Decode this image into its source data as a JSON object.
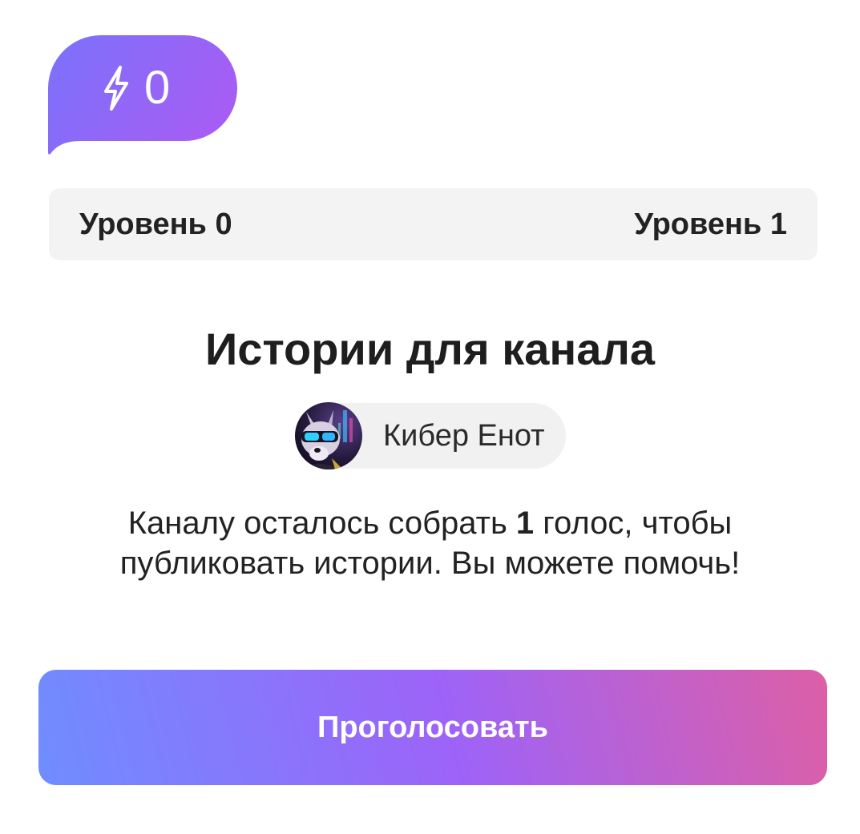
{
  "boost": {
    "count": "0",
    "icon": "lightning-bolt-icon",
    "gradient": [
      "#7a6ffb",
      "#a15cf4"
    ]
  },
  "levels": {
    "current": "Уровень 0",
    "next": "Уровень 1",
    "progress_fraction": 0
  },
  "title": "Истории для канала",
  "channel": {
    "name": "Кибер Енот",
    "avatar_icon": "raccoon-avatar-icon"
  },
  "description": {
    "before": "Каналу осталось собрать ",
    "count": "1",
    "after": " голос, чтобы публиковать истории. Вы можете помочь!"
  },
  "actions": {
    "vote_label": "Проголосовать"
  },
  "colors": {
    "accent_start": "#6f8dff",
    "accent_mid": "#9d63f8",
    "accent_end": "#dd5fa6",
    "level_bar_bg": "#f3f3f4"
  }
}
